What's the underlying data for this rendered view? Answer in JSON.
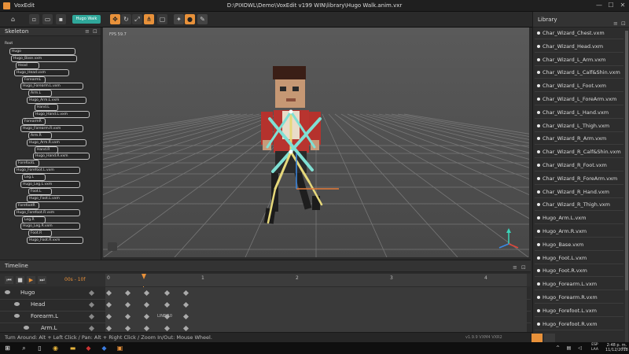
{
  "window": {
    "app_name": "VoxEdit",
    "title": "D:\\PIXOWL\\Demo\\VoxEdit v199 WIN\\library\\Hugo Walk.anim.vxr",
    "minimize": "—",
    "maximize": "☐",
    "close": "✕"
  },
  "toolbar": {
    "hugo_walk_label": "Hugo Walk"
  },
  "skeleton": {
    "title": "Skeleton",
    "nodes": [
      "Root",
      "Hugo",
      "Hugo_Base.vxm",
      "Head",
      "Hugo_Head.vxm",
      "ForearmL",
      "Hugo_Forearm.L.vxm",
      "Arm.L",
      "Hugo_Arm.L.vxm",
      "Hand.L",
      "Hugo_Hand.L.vxm",
      "ForearmR",
      "Hugo_Forearm.R.vxm",
      "Arm.R",
      "Hugo_Arm.R.vxm",
      "Hand.R",
      "Hugo_Hand.R.vxm",
      "ForefootL",
      "Hugo_Forefoot.L.vxm",
      "Leg.L",
      "Hugo_Leg.L.vxm",
      "Foot.L",
      "Hugo_Foot.L.vxm",
      "ForefootR",
      "Hugo_Forefoot.R.vxm",
      "Leg.R",
      "Hugo_Leg.R.vxm",
      "Foot.R",
      "Hugo_Foot.R.vxm"
    ]
  },
  "viewport": {
    "fps": "FPS 59.7"
  },
  "library": {
    "title": "Library",
    "items": [
      "Char_Wizard_Chest.vxm",
      "Char_Wizard_Head.vxm",
      "Char_Wizard_L_Arm.vxm",
      "Char_Wizard_L_Calf&Shin.vxm",
      "Char_Wizard_L_Foot.vxm",
      "Char_Wizard_L_ForeArm.vxm",
      "Char_Wizard_L_Hand.vxm",
      "Char_Wizard_L_Thigh.vxm",
      "Char_Wizard_R_Arm.vxm",
      "Char_Wizard_R_Calf&Shin.vxm",
      "Char_Wizard_R_Foot.vxm",
      "Char_Wizard_R_ForeArm.vxm",
      "Char_Wizard_R_Hand.vxm",
      "Char_Wizard_R_Thigh.vxm",
      "Hugo_Arm.L.vxm",
      "Hugo_Arm.R.vxm",
      "Hugo_Base.vxm",
      "Hugo_Foot.L.vxm",
      "Hugo_Foot.R.vxm",
      "Hugo_Forearm.L.vxm",
      "Hugo_Forearm.R.vxm",
      "Hugo_Forefoot.L.vxm",
      "Hugo_Forefoot.R.vxm"
    ]
  },
  "timeline": {
    "title": "Timeline",
    "time": "00s - 10f",
    "ruler": [
      "0",
      "1",
      "2",
      "3",
      "4"
    ],
    "tracks": [
      "Hugo",
      "Head",
      "Forearm.L",
      "Arm.L"
    ],
    "frame_label": "LINE 10"
  },
  "status": {
    "help": "Turn Around: Alt + Left Click / Pan: Alt + Right Click / Zoom In/Out: Mouse Wheel.",
    "version": "v1.9.9 VXM4 VXR2"
  },
  "taskbar": {
    "lang_top": "ESP",
    "lang_bottom": "LAA",
    "time": "2:48 p. m.",
    "date": "11/12/2018"
  },
  "colors": {
    "accent": "#e8913a",
    "teal": "#2fa79a",
    "bone": "#7fe0d4",
    "bone_yellow": "#e6d87a"
  }
}
